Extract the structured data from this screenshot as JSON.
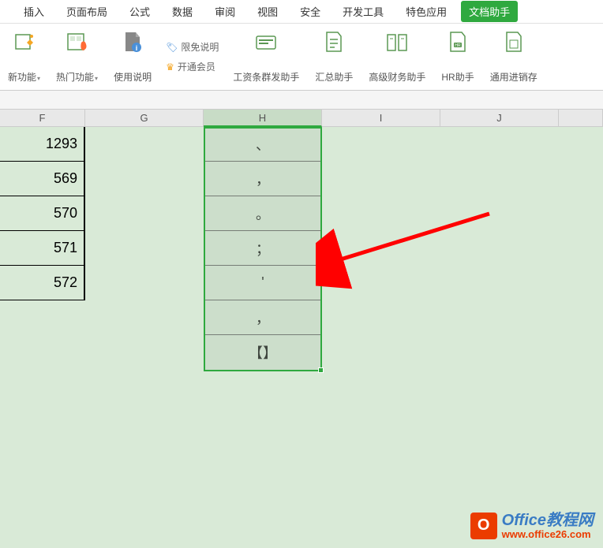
{
  "tabs": {
    "insert": "插入",
    "pageLayout": "页面布局",
    "formula": "公式",
    "data": "数据",
    "review": "审阅",
    "view": "视图",
    "security": "安全",
    "devTools": "开发工具",
    "special": "特色应用",
    "docHelper": "文档助手"
  },
  "toolbar": {
    "newFeature": "新功能",
    "hotFeature": "热门功能",
    "usageHelp": "使用说明",
    "freeInfo": "限免说明",
    "openMember": "开通会员",
    "payrollHelper": "工资条群发助手",
    "summaryHelper": "汇总助手",
    "financeHelper": "高级财务助手",
    "hrHelper": "HR助手",
    "inventoryHelper": "通用进销存"
  },
  "columns": {
    "f": "F",
    "g": "G",
    "h": "H",
    "i": "I",
    "j": "J"
  },
  "fData": [
    "1293",
    "569",
    "570",
    "571",
    "572"
  ],
  "hData": [
    "、",
    "，",
    "。",
    "；",
    "'",
    "，",
    "【】"
  ],
  "watermark": {
    "title": "Office教程网",
    "url": "www.office26.com"
  }
}
